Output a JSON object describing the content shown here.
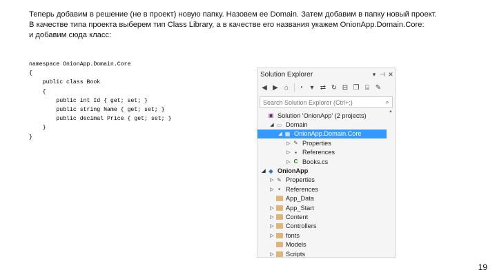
{
  "intro": {
    "line1": "Теперь добавим в решение (не в проект) новую папку. Назовем ее Domain. Затем добавим в папку новый проект.",
    "line2": "В качестве типа проекта выберем тип Class Library, а в качестве его названия укажем OnionApp.Domain.Core:",
    "line3": "и добавим сюда класс:"
  },
  "code": [
    "namespace OnionApp.Domain.Core",
    "{",
    "    public class Book",
    "    {",
    "        public int Id { get; set; }",
    "        public string Name { get; set; }",
    "        public decimal Price { get; set; }",
    "    }",
    "}"
  ],
  "solution_explorer": {
    "title": "Solution Explorer",
    "title_buttons": [
      "▾",
      "⊣",
      "✕"
    ],
    "search_placeholder": "Search Solution Explorer (Ctrl+;)",
    "tree": [
      {
        "label": "Solution 'OnionApp' (2 projects)",
        "arrow": "",
        "icon": "solution-icon",
        "depth": 0
      },
      {
        "label": "Domain",
        "arrow": "◢",
        "icon": "solution-folder-icon",
        "depth": 1
      },
      {
        "label": "OnionApp.Domain.Core",
        "arrow": "◢",
        "icon": "csharp-project-icon",
        "depth": 2,
        "selected": true
      },
      {
        "label": "Properties",
        "arrow": "▷",
        "icon": "wrench-icon",
        "depth": 3
      },
      {
        "label": "References",
        "arrow": "▷",
        "icon": "references-icon",
        "depth": 3
      },
      {
        "label": "Books.cs",
        "arrow": "▷",
        "icon": "csharp-file-icon",
        "depth": 3
      },
      {
        "label": "OnionApp",
        "arrow": "◢",
        "icon": "web-project-icon",
        "depth": 0,
        "bold": true
      },
      {
        "label": "Properties",
        "arrow": "▷",
        "icon": "wrench-icon",
        "depth": 1
      },
      {
        "label": "References",
        "arrow": "▷",
        "icon": "references-icon",
        "depth": 1
      },
      {
        "label": "App_Data",
        "arrow": "",
        "icon": "folder-icon",
        "depth": 1
      },
      {
        "label": "App_Start",
        "arrow": "▷",
        "icon": "folder-icon",
        "depth": 1
      },
      {
        "label": "Content",
        "arrow": "▷",
        "icon": "folder-icon",
        "depth": 1
      },
      {
        "label": "Controllers",
        "arrow": "▷",
        "icon": "folder-icon",
        "depth": 1
      },
      {
        "label": "fonts",
        "arrow": "▷",
        "icon": "folder-icon",
        "depth": 1
      },
      {
        "label": "Models",
        "arrow": "",
        "icon": "folder-icon",
        "depth": 1
      },
      {
        "label": "Scripts",
        "arrow": "▷",
        "icon": "folder-icon",
        "depth": 1
      }
    ]
  },
  "page_number": "19"
}
